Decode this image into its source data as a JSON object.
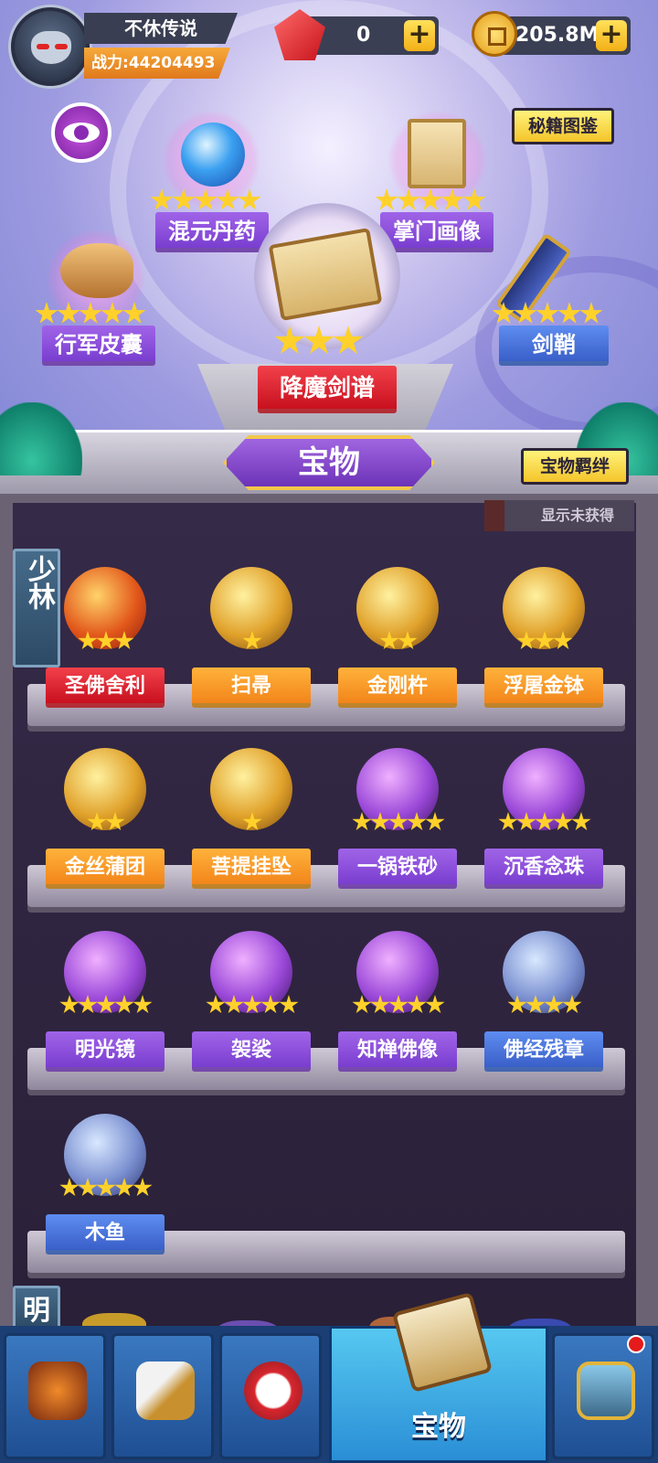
{
  "player": {
    "name": "不休传说",
    "power_label": "战力:",
    "power": "44204493"
  },
  "currency": {
    "gems": "0",
    "coins": "205.8M",
    "add_symbol": "+"
  },
  "top_buttons": {
    "codex": "秘籍图鉴",
    "bond": "宝物羁绊"
  },
  "featured": [
    {
      "name": "混元丹药",
      "stars": 5,
      "color": "purple"
    },
    {
      "name": "掌门画像",
      "stars": 5,
      "color": "purple"
    },
    {
      "name": "行军皮囊",
      "stars": 5,
      "color": "purple"
    },
    {
      "name": "剑鞘",
      "stars": 5,
      "color": "blue"
    },
    {
      "name": "降魔剑谱",
      "stars": 3,
      "color": "red"
    }
  ],
  "panel_title": "宝物",
  "filter_toggle": "显示未获得",
  "sections": [
    {
      "tab": "少林"
    },
    {
      "tab": "明"
    }
  ],
  "items": [
    {
      "name": "圣佛舍利",
      "stars": 3,
      "color": "red"
    },
    {
      "name": "扫帚",
      "stars": 1,
      "color": "orange"
    },
    {
      "name": "金刚杵",
      "stars": 2,
      "color": "orange"
    },
    {
      "name": "浮屠金钵",
      "stars": 3,
      "color": "orange"
    },
    {
      "name": "金丝蒲团",
      "stars": 2,
      "color": "orange"
    },
    {
      "name": "菩提挂坠",
      "stars": 1,
      "color": "orange"
    },
    {
      "name": "一锅铁砂",
      "stars": 5,
      "color": "purple"
    },
    {
      "name": "沉香念珠",
      "stars": 5,
      "color": "purple"
    },
    {
      "name": "明光镜",
      "stars": 5,
      "color": "purple"
    },
    {
      "name": "袈裟",
      "stars": 5,
      "color": "purple"
    },
    {
      "name": "知禅佛像",
      "stars": 5,
      "color": "purple"
    },
    {
      "name": "佛经残章",
      "stars": 4,
      "color": "blue"
    },
    {
      "name": "木鱼",
      "stars": 5,
      "color": "blue"
    }
  ],
  "nav": {
    "active_label": "宝物",
    "has_notification": true
  },
  "colors": {
    "purple": "#8b4fdf",
    "blue": "#4a74dc",
    "orange": "#f59a26",
    "red": "#d8202d",
    "star": "#ffd12a"
  }
}
